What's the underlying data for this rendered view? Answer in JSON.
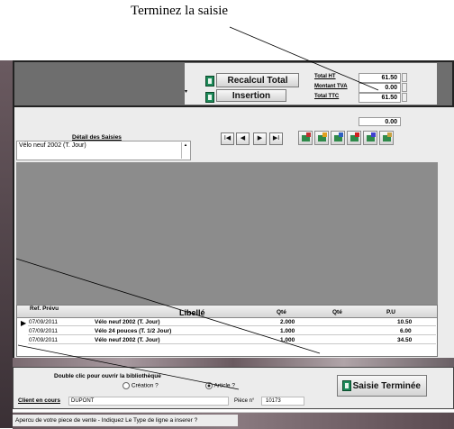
{
  "annotation_top": "Terminez la saisie",
  "totals": {
    "buttons": {
      "recalc": "Recalcul Total",
      "insert": "Insertion"
    },
    "labels": {
      "ht": "Total HT",
      "tva": "Montant TVA",
      "ttc": "Total TTC"
    },
    "values": {
      "ht": "61.50",
      "tva": "0.00",
      "ttc": "61.50"
    }
  },
  "detail": {
    "title": "Détail des Saisies",
    "text": "Vélo neuf 2002 (T. Jour)",
    "amount": "0.00"
  },
  "nav_buttons": [
    "I◀",
    "◀",
    "▶",
    "▶I"
  ],
  "table": {
    "headers": [
      "Ref. Prévu",
      "Libellé",
      "Qté",
      "Qté",
      "P.U"
    ],
    "rows": [
      {
        "date": "07/09/2011",
        "label": "Vélo neuf 2002 (T. Jour)",
        "qty": "2.000",
        "pu": "10.50"
      },
      {
        "date": "07/09/2011",
        "label": "Vélo 24 pouces (T. 1/2 Jour)",
        "qty": "1.000",
        "pu": "6.00"
      },
      {
        "date": "07/09/2011",
        "label": "Vélo neuf 2002 (T. Jour)",
        "qty": "1.000",
        "pu": "34.50"
      }
    ]
  },
  "bottom": {
    "library_hint": "Double clic pour ouvrir la bibliothèque",
    "radio_creation": "Création ?",
    "radio_article": "Article ?",
    "client_label": "Client en cours",
    "client_value": "DUPONT",
    "piece_label": "Pièce n°",
    "piece_value": "10173",
    "finish_button": "Saisie Terminée",
    "status": "Apercu de votre piece de vente - Indiquez Le Type de ligne a inserer ?"
  },
  "colors": {
    "grid_gray": "#8c8c8c",
    "panel": "#ececec",
    "accent_green": "#1e8a5a"
  }
}
